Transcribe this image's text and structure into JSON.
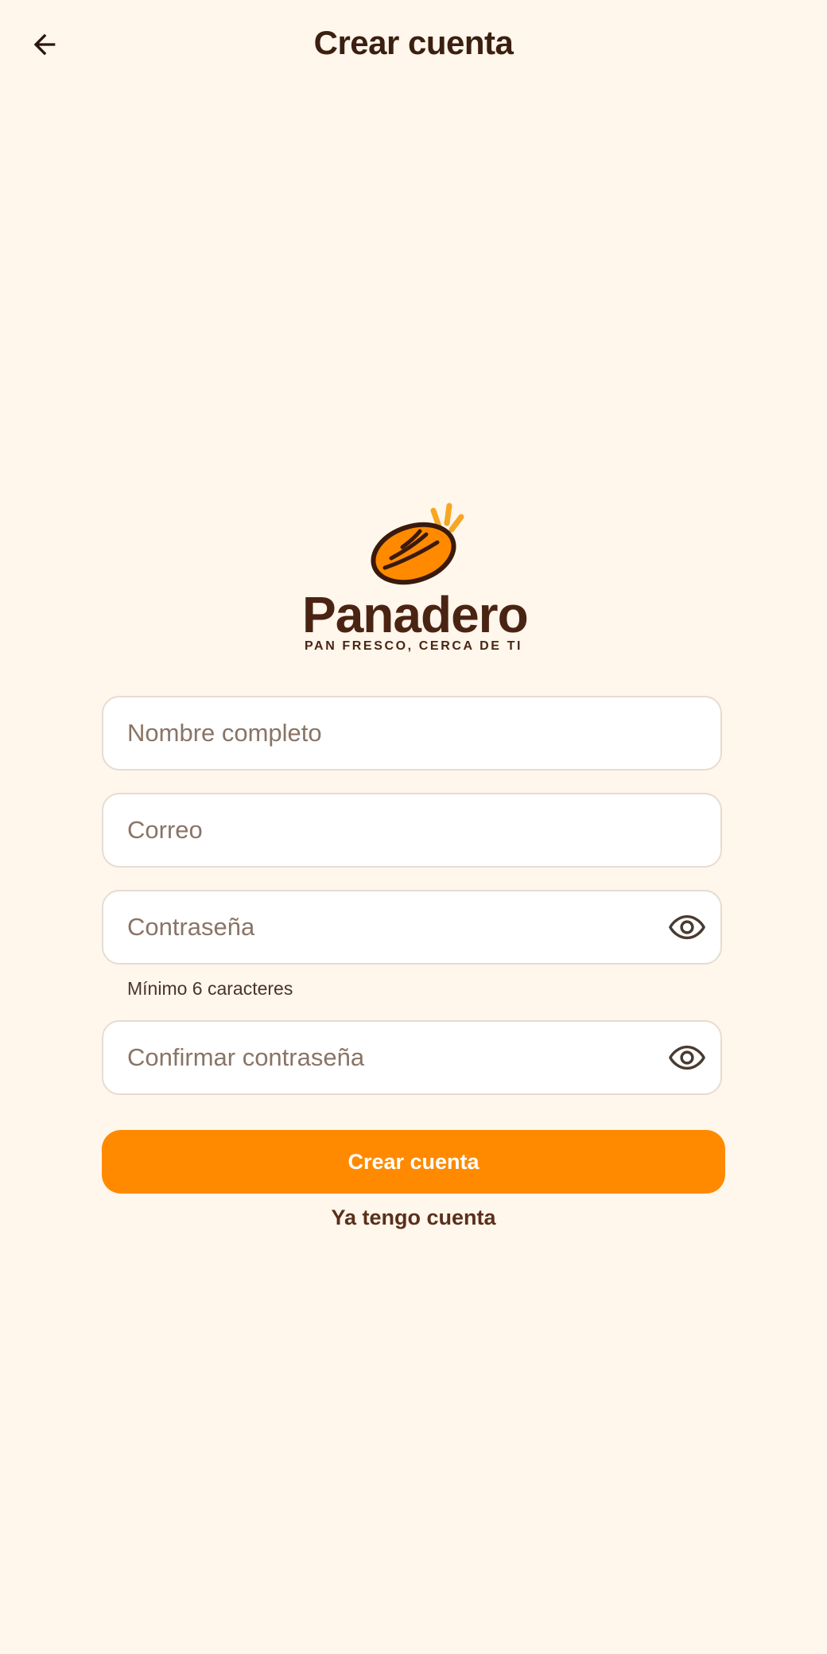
{
  "header": {
    "title": "Crear cuenta",
    "back_icon": "arrow-left-icon"
  },
  "brand": {
    "name": "Panadero",
    "tagline": "PAN FRESCO, CERCA DE TI",
    "logo_icon": "bread-icon",
    "colors": {
      "accent": "#ff8a00",
      "brown": "#4a2413",
      "background": "#fff6ec"
    }
  },
  "form": {
    "full_name": {
      "placeholder": "Nombre completo",
      "value": ""
    },
    "email": {
      "placeholder": "Correo",
      "value": ""
    },
    "password": {
      "placeholder": "Contraseña",
      "value": "",
      "helper": "Mínimo 6 caracteres",
      "toggle_icon": "eye-icon"
    },
    "confirm_password": {
      "placeholder": "Confirmar contraseña",
      "value": "",
      "toggle_icon": "eye-icon"
    }
  },
  "actions": {
    "create_label": "Crear cuenta",
    "login_link": "Ya tengo cuenta"
  }
}
